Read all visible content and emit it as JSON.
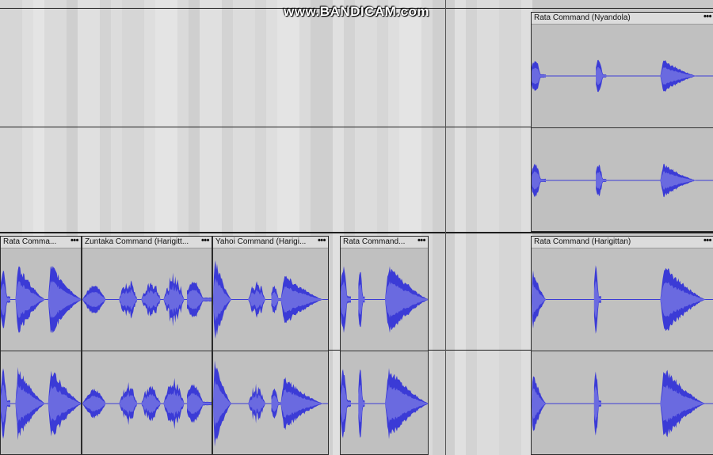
{
  "watermark": "www.BANDICAM.com",
  "colors": {
    "wave": "#3b3bd6",
    "wave_rms": "#6a6ae0",
    "clip_bg": "#c0c0c0",
    "header_bg": "#dcdcdc"
  },
  "tracks": [
    {
      "clips": [
        {
          "title": "Rata Command (Nyandola)",
          "menu": "•••"
        }
      ]
    },
    {
      "clips": [
        {
          "title": "Rata Comma...",
          "menu": "•••"
        },
        {
          "title": "Zuntaka Command (Harigitt...",
          "menu": "•••"
        },
        {
          "title": "Yahoi Command (Harigi...",
          "menu": "•••"
        },
        {
          "title": "Rata Command...",
          "menu": "•••"
        },
        {
          "title": "Rata Command (Harigittan)",
          "menu": "•••"
        }
      ]
    }
  ]
}
